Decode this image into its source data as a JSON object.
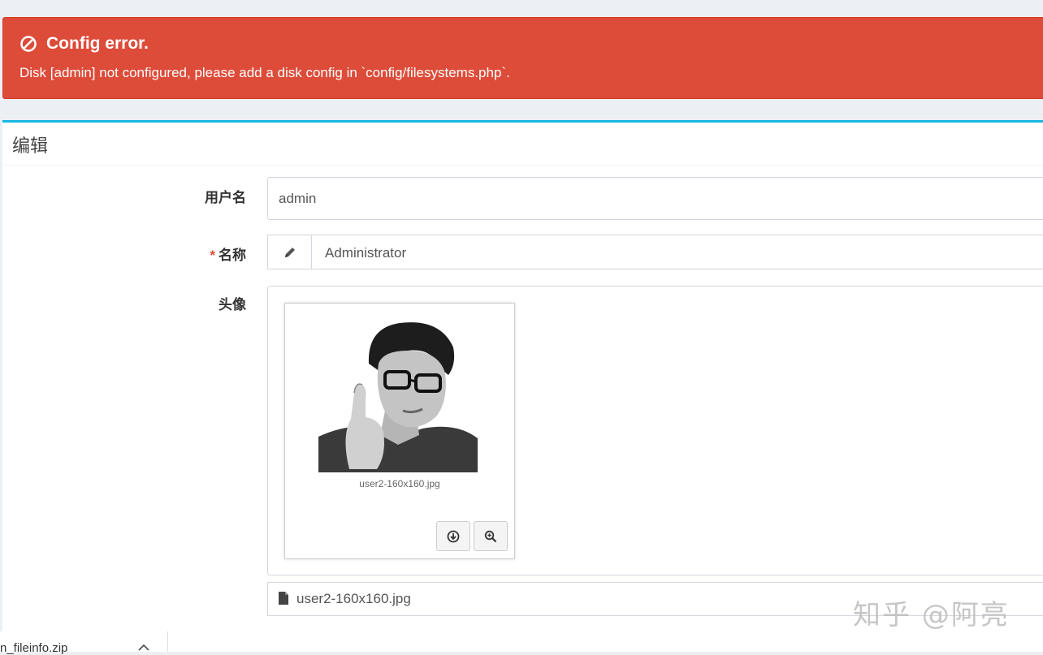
{
  "alert": {
    "title": "Config error.",
    "message": "Disk [admin] not configured, please add a disk config in `config/filesystems.php`.",
    "icon": "ban-icon",
    "color": "#dd4b39"
  },
  "panel": {
    "title": "编辑",
    "accent": "#17b8e2"
  },
  "form": {
    "username": {
      "label": "用户名",
      "value": "admin"
    },
    "name": {
      "required_mark": "*",
      "label": "名称",
      "value": "Administrator",
      "icon": "pencil-icon"
    },
    "avatar": {
      "label": "头像",
      "file_caption": "user2-160x160.jpg",
      "buttons": [
        {
          "icon": "download-icon"
        },
        {
          "icon": "zoom-in-icon"
        }
      ],
      "filename_field": "user2-160x160.jpg",
      "file_icon": "file-icon"
    }
  },
  "watermark": "知乎 @阿亮",
  "download_bar": {
    "file": "n_fileinfo.zip"
  }
}
